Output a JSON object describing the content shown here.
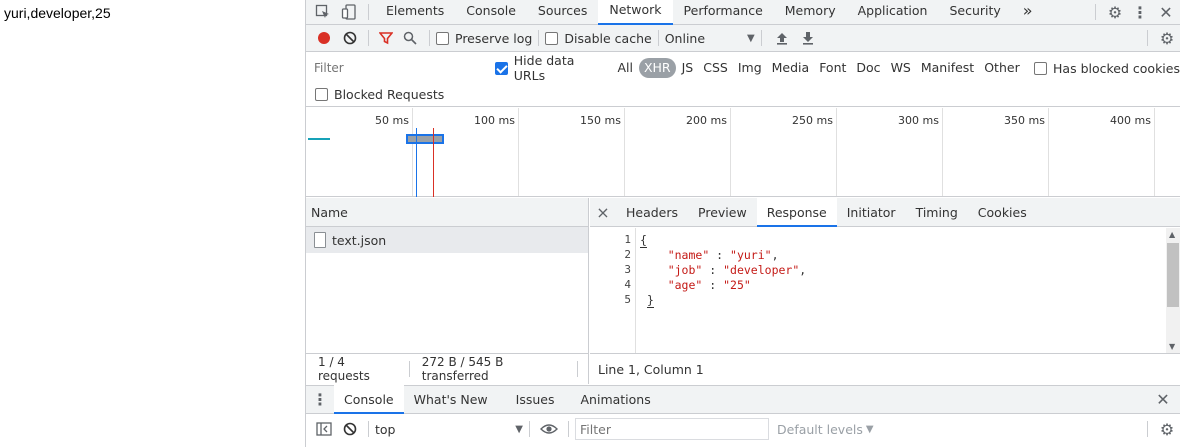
{
  "page": {
    "text": "yuri,developer,25"
  },
  "devtools": {
    "main_tabs": [
      "Elements",
      "Console",
      "Sources",
      "Network",
      "Performance",
      "Memory",
      "Application",
      "Security"
    ],
    "more_tabs": "»",
    "toolbar": {
      "preserve_log": "Preserve log",
      "disable_cache": "Disable cache",
      "throttle": "Online"
    },
    "filter": {
      "placeholder": "Filter",
      "hide_data_urls": "Hide data URLs",
      "types": [
        "All",
        "XHR",
        "JS",
        "CSS",
        "Img",
        "Media",
        "Font",
        "Doc",
        "WS",
        "Manifest",
        "Other"
      ],
      "active_type": "XHR",
      "has_blocked_cookies": "Has blocked cookies",
      "blocked_requests": "Blocked Requests"
    },
    "timeline": {
      "ticks": [
        "50 ms",
        "100 ms",
        "150 ms",
        "200 ms",
        "250 ms",
        "300 ms",
        "350 ms",
        "400 ms"
      ]
    },
    "requests": {
      "header": "Name",
      "items": [
        "text.json"
      ],
      "summary_requests": "1 / 4 requests",
      "summary_transferred": "272 B / 545 B transferred"
    },
    "detail": {
      "close": "×",
      "tabs": [
        "Headers",
        "Preview",
        "Response",
        "Initiator",
        "Timing",
        "Cookies"
      ],
      "active": "Response",
      "line_numbers": [
        "1",
        "2",
        "3",
        "4",
        "5"
      ],
      "code": {
        "open": "{",
        "name_key": "\"name\"",
        "name_val": "\"yuri\"",
        "job_key": "\"job\"",
        "job_val": "\"developer\"",
        "age_key": "\"age\"",
        "age_val": "\"25\"",
        "close": "}"
      },
      "status": "Line 1, Column 1"
    },
    "drawer": {
      "tabs": [
        "Console",
        "What's New",
        "Issues",
        "Animations"
      ],
      "active": "Console",
      "context": "top",
      "filter_placeholder": "Filter",
      "levels": "Default levels"
    }
  }
}
